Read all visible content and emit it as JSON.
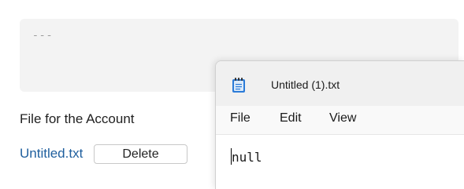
{
  "form": {
    "text_area_content": "---",
    "file_section_label": "File for the Account",
    "file_name": "Untitled.txt",
    "delete_label": "Delete"
  },
  "notepad": {
    "window_title": "Untitled (1).txt",
    "menu": [
      {
        "label": "File"
      },
      {
        "label": "Edit"
      },
      {
        "label": "View"
      }
    ],
    "content": "null",
    "app_icon": "notepad-icon"
  },
  "colors": {
    "link": "#1f5f9e",
    "panel_bg": "#f3f3f3",
    "notepad_icon_blue": "#2b7bd8"
  }
}
